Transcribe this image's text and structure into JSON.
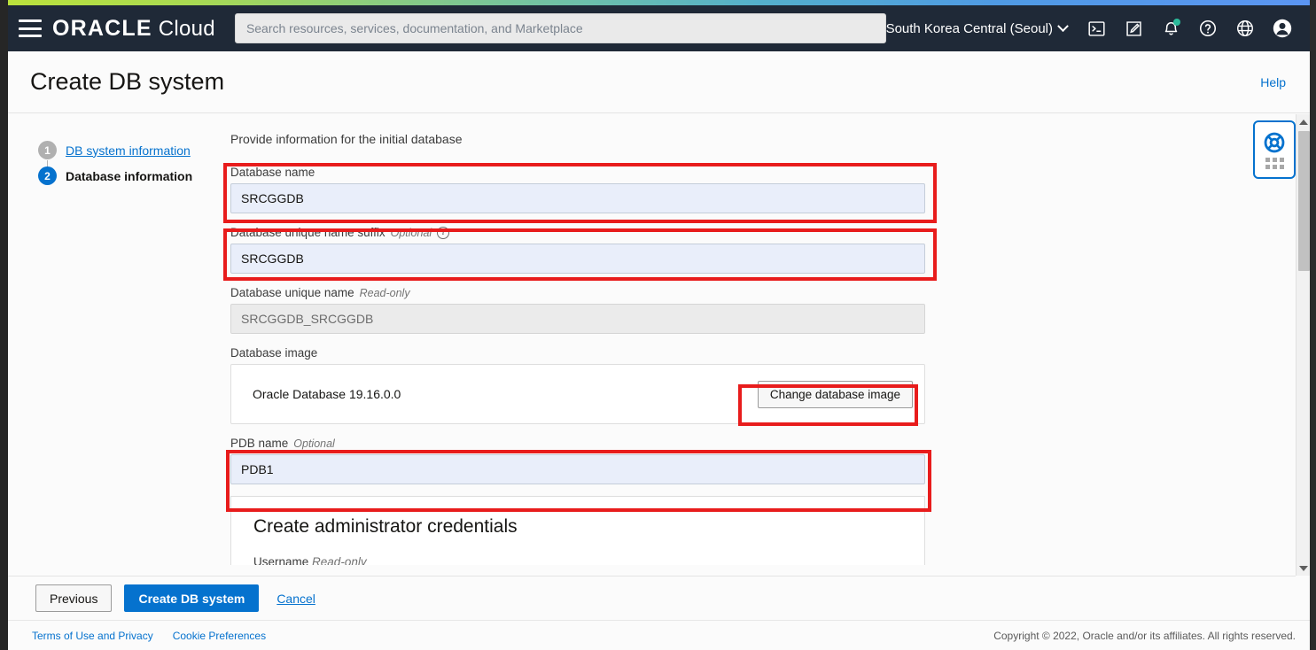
{
  "topnav": {
    "brand_oracle": "ORACLE",
    "brand_cloud": "Cloud",
    "search_placeholder": "Search resources, services, documentation, and Marketplace",
    "search_value": "",
    "region": "South Korea Central (Seoul)",
    "icons": [
      "cloud-shell-icon",
      "notes-icon",
      "notifications-bell-icon",
      "help-circle-icon",
      "language-globe-icon",
      "user-avatar-icon"
    ]
  },
  "page_header": {
    "title": "Create DB system",
    "help_label": "Help"
  },
  "steps": [
    {
      "number": "1",
      "label": "DB system information",
      "state": "completed"
    },
    {
      "number": "2",
      "label": "Database information",
      "state": "current"
    }
  ],
  "form": {
    "intro": "Provide information for the initial database",
    "database_name": {
      "label": "Database name",
      "value": "SRCGGDB",
      "placeholder": ""
    },
    "database_unique_name_suffix": {
      "label": "Database unique name suffix",
      "hint": "Optional",
      "info_glyph": "i",
      "value": "SRCGGDB",
      "placeholder": ""
    },
    "database_unique_name": {
      "label": "Database unique name",
      "hint": "Read-only",
      "value": "SRCGGDB_SRCGGDB"
    },
    "database_image": {
      "label": "Database image",
      "name": "Oracle Database 19.16.0.0",
      "change_button": "Change database image"
    },
    "pdb_name": {
      "label": "PDB name",
      "hint": "Optional",
      "value": "PDB1",
      "placeholder": ""
    },
    "admin_section": {
      "heading": "Create administrator credentials",
      "username_label": "Username",
      "username_hint": "Read-only"
    }
  },
  "support_widget": {
    "icon": "lifesaver-support-icon",
    "drag_handle": "dots-grid-handle"
  },
  "scrollbar": {
    "up_arrow": "scroll-up-arrow",
    "down_arrow": "scroll-down-arrow"
  },
  "actions": {
    "previous": "Previous",
    "create": "Create DB system",
    "cancel": "Cancel"
  },
  "footer": {
    "terms": "Terms of Use and Privacy",
    "cookies": "Cookie Preferences",
    "copyright": "Copyright © 2022, Oracle and/or its affiliates. All rights reserved."
  },
  "colors": {
    "accent_blue": "#0572ce",
    "nav_dark": "#1f2937",
    "highlight_red": "#e81c1c",
    "input_bg": "#e9eefa",
    "gradient_start": "#bbe23c",
    "gradient_end": "#5b95f2"
  }
}
